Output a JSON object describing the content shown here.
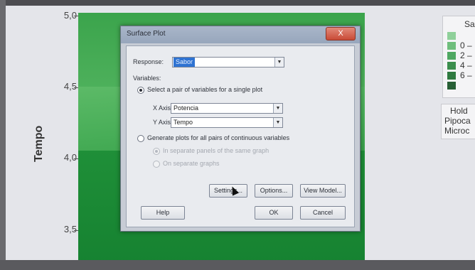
{
  "plot": {
    "y_axis_label": "Tempo",
    "y_ticks": [
      "5,0",
      "4,5",
      "4,0",
      "3,5"
    ],
    "colors": [
      "#3ba44c",
      "#5cba67",
      "#1f8f38"
    ]
  },
  "legend": {
    "title": "Sab",
    "items": [
      {
        "label": "",
        "color": "#8fd09a"
      },
      {
        "label": "0 –",
        "color": "#6fbe7c"
      },
      {
        "label": "2 –",
        "color": "#4fa862"
      },
      {
        "label": "4 –",
        "color": "#3b8e4d"
      },
      {
        "label": "6 –",
        "color": "#2f7a40"
      },
      {
        "label": "",
        "color": "#275f35"
      }
    ]
  },
  "hold_values": {
    "lines": [
      "Hold",
      "Pipoca",
      "Microc"
    ]
  },
  "dialog": {
    "title": "Surface Plot",
    "close_label": "X",
    "response_label": "Response:",
    "response_value": "Sabor",
    "variables_label": "Variables:",
    "radio_single_label": "Select a pair of variables for a single plot",
    "x_axis_label": "X Axis:",
    "x_axis_value": "Potencia",
    "y_axis_label": "Y Axis:",
    "y_axis_value": "Tempo",
    "radio_all_label": "Generate plots for all pairs of continuous variables",
    "sub_radio_same_graph": "In separate panels of the same graph",
    "sub_radio_separate": "On separate graphs",
    "buttons": {
      "settings": "Settings...",
      "options": "Options...",
      "view_model": "View Model...",
      "help": "Help",
      "ok": "OK",
      "cancel": "Cancel"
    }
  }
}
